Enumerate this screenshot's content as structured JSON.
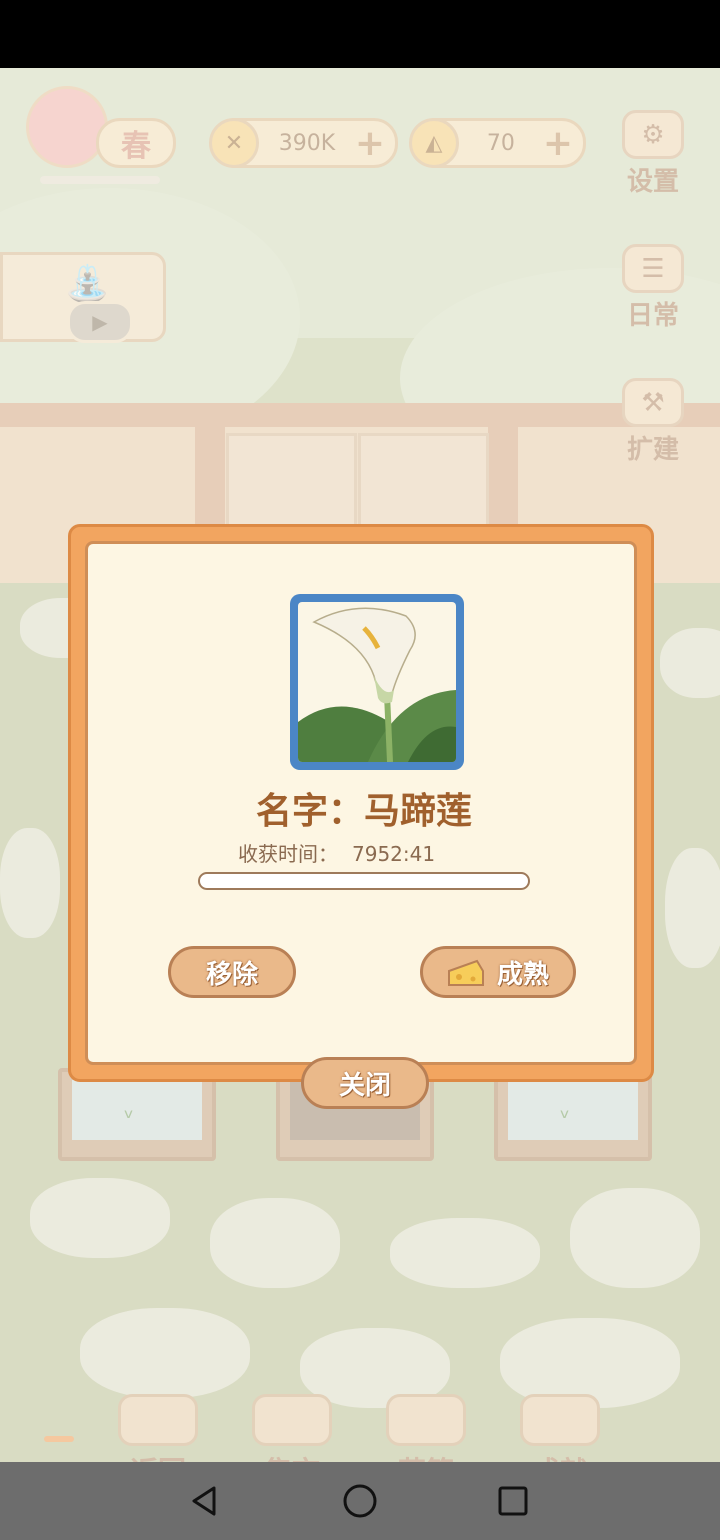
{
  "hud": {
    "season": "春",
    "fish_amount": "390K",
    "cheese_amount": "70"
  },
  "side_menu": {
    "settings": "设置",
    "daily": "日常",
    "expand": "扩建"
  },
  "bottom_menu": {
    "back": "返回",
    "market": "集市",
    "basket": "花篮",
    "achievements": "成就"
  },
  "plant_dialog": {
    "name_label": "名字：",
    "name_value": "马蹄莲",
    "harvest_label": "收获时间：",
    "harvest_value": "7952:41",
    "progress_fraction": 0.0,
    "remove_label": "移除",
    "ripen_label": "成熟",
    "close_label": "关闭"
  },
  "colors": {
    "modal_border": "#f2a560",
    "modal_background": "#fdf6e3",
    "image_frame": "#4b86c6",
    "button_fill": "#eab98a",
    "title_text": "#a0602d"
  },
  "icons": [
    "fish-bone-icon",
    "cheese-icon",
    "plus-icon",
    "gear-icon",
    "checklist-icon",
    "hammer-icon",
    "watering-can-icon",
    "play-icon",
    "calla-lily-image",
    "back-triangle-icon",
    "home-circle-icon",
    "recent-square-icon"
  ]
}
